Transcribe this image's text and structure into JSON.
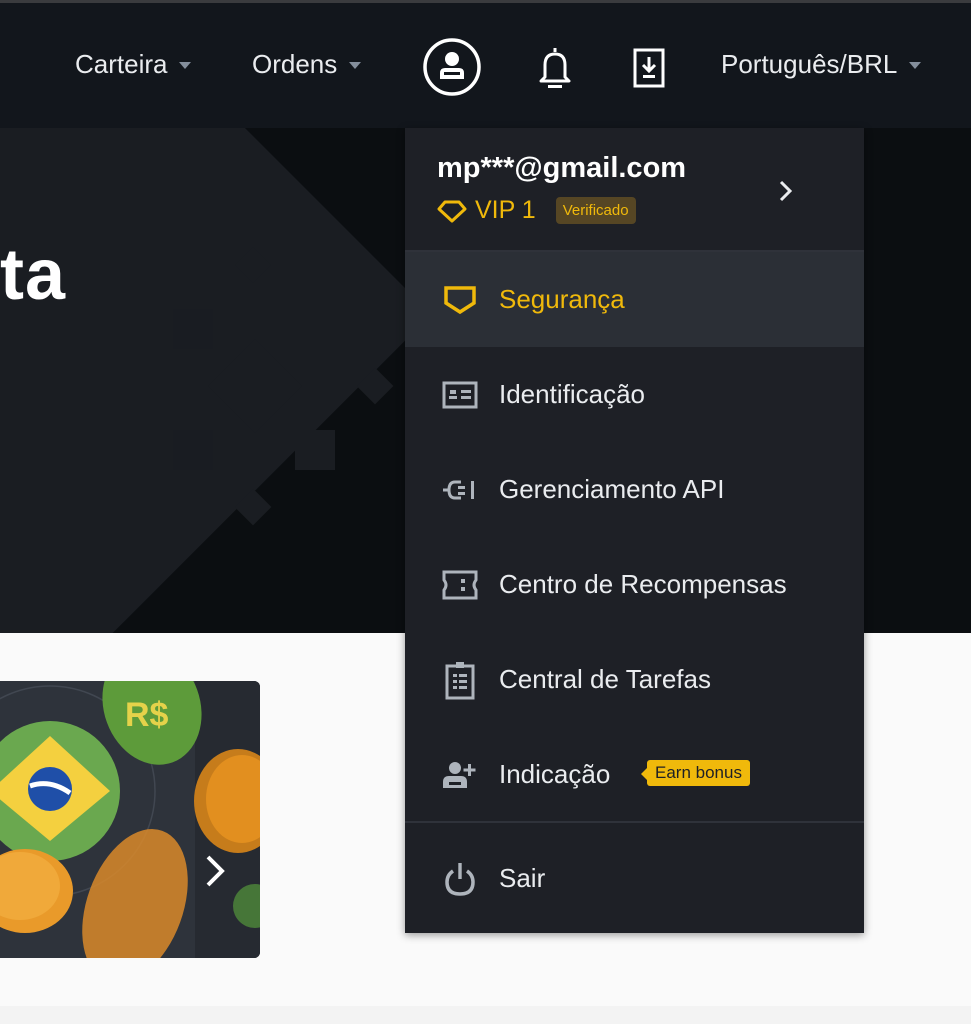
{
  "header": {
    "nav": [
      {
        "label": "Carteira",
        "has_dropdown": true
      },
      {
        "label": "Ordens",
        "has_dropdown": true
      }
    ],
    "icons": [
      "user-avatar-icon",
      "bell-icon",
      "download-app-icon"
    ],
    "language": {
      "label": "Português/BRL",
      "has_dropdown": true
    }
  },
  "hero": {
    "title_fragment": "ta"
  },
  "banner": {
    "coin_label": "R$",
    "next_icon": "chevron-right-icon"
  },
  "account_menu": {
    "email": "mp***@gmail.com",
    "vip_level": "VIP 1",
    "verification_badge": "Verificado",
    "items": [
      {
        "label": "Segurança",
        "icon": "shield-icon",
        "active": true
      },
      {
        "label": "Identificação",
        "icon": "id-card-icon",
        "active": false
      },
      {
        "label": "Gerenciamento API",
        "icon": "plug-icon",
        "active": false
      },
      {
        "label": "Centro de Recompensas",
        "icon": "ticket-icon",
        "active": false
      },
      {
        "label": "Central de Tarefas",
        "icon": "clipboard-icon",
        "active": false
      },
      {
        "label": "Indicação",
        "icon": "add-user-icon",
        "active": false,
        "badge": "Earn bonus"
      }
    ],
    "logout": {
      "label": "Sair",
      "icon": "power-icon"
    }
  },
  "colors": {
    "accent": "#f0b90b",
    "header_bg": "#12161c",
    "menu_bg": "#1e2026",
    "menu_active_bg": "#2b2f36",
    "text_primary": "#eaecef",
    "icon_gray": "#aeb4bc"
  }
}
